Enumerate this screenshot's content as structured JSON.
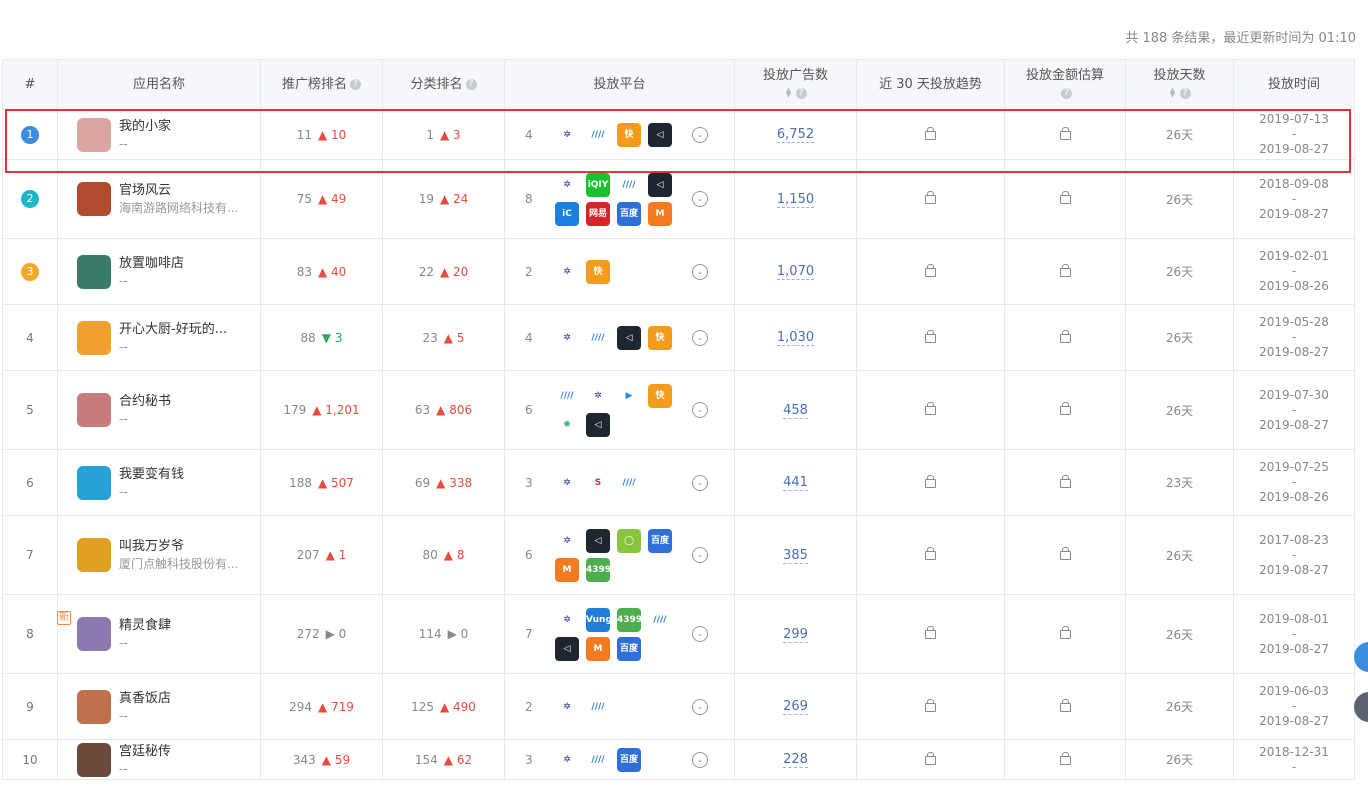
{
  "summary": "共 188 条结果，最近更新时间为 01:10",
  "headers": {
    "idx": "#",
    "name": "应用名称",
    "promo": "推广榜排名",
    "cat": "分类排名",
    "platform": "投放平台",
    "ads": "投放广告数",
    "trend": "近 30 天投放趋势",
    "amount": "投放金额估算",
    "days": "投放天数",
    "time": "投放时间"
  },
  "help_glyph": "?",
  "new_tag": "新",
  "platform_labels": {
    "iqiyi": "iQIY",
    "idea": "iC",
    "wy": "网易",
    "baidu": "百度",
    "vungle": "Vungle",
    "4399": "4399",
    "mgtv": "M",
    "kuaishou": "快"
  },
  "colors": {
    "highlight": "#d9363e",
    "up": "#e84c3d",
    "down": "#27ae60",
    "ads_link": "#4a6fb5",
    "rank1": "#3b8de0",
    "rank2": "#1fb5c9",
    "rank3": "#f5a623"
  },
  "rows": [
    {
      "rank": "1",
      "name": "我的小家",
      "dev": "--",
      "promo": "11",
      "promo_dir": "up",
      "promo_delta": "10",
      "cat": "1",
      "cat_dir": "up",
      "cat_delta": "3",
      "pcount": "4",
      "platforms": [
        "pangle",
        "ks",
        "kuaishou",
        "jl"
      ],
      "ads": "6,752",
      "days": "26天",
      "start": "2019-07-13",
      "sep": "-",
      "end": "2019-08-27",
      "icon": "#d9a7a0"
    },
    {
      "rank": "2",
      "name": "官场风云",
      "dev": "海南游路网络科技有...",
      "promo": "75",
      "promo_dir": "up",
      "promo_delta": "49",
      "cat": "19",
      "cat_dir": "up",
      "cat_delta": "24",
      "pcount": "8",
      "platforms": [
        "pangle",
        "iqiyi",
        "ks",
        "jl",
        "idea",
        "wy",
        "baidu",
        "mgtv"
      ],
      "ads": "1,150",
      "days": "26天",
      "start": "2018-09-08",
      "sep": "-",
      "end": "2019-08-27",
      "icon": "#b34a2e"
    },
    {
      "rank": "3",
      "name": "放置咖啡店",
      "dev": "--",
      "promo": "83",
      "promo_dir": "up",
      "promo_delta": "40",
      "cat": "22",
      "cat_dir": "up",
      "cat_delta": "20",
      "pcount": "2",
      "platforms": [
        "pangle",
        "kuaishou"
      ],
      "ads": "1,070",
      "days": "26天",
      "start": "2019-02-01",
      "sep": "-",
      "end": "2019-08-26",
      "icon": "#3a7a6a"
    },
    {
      "rank": "4",
      "name": "开心大厨-好玩的...",
      "dev": "--",
      "promo": "88",
      "promo_dir": "down",
      "promo_delta": "3",
      "cat": "23",
      "cat_dir": "up",
      "cat_delta": "5",
      "pcount": "4",
      "platforms": [
        "pangle",
        "ks",
        "jl",
        "kuaishou"
      ],
      "ads": "1,030",
      "days": "26天",
      "start": "2019-05-28",
      "sep": "-",
      "end": "2019-08-27",
      "icon": "#f0a030"
    },
    {
      "rank": "5",
      "name": "合约秘书",
      "dev": "--",
      "promo": "179",
      "promo_dir": "up",
      "promo_delta": "1,201",
      "cat": "63",
      "cat_dir": "up",
      "cat_delta": "806",
      "pcount": "6",
      "platforms": [
        "ks",
        "pangle",
        "tx",
        "kuaishou",
        "gdt",
        "jl"
      ],
      "ads": "458",
      "days": "26天",
      "start": "2019-07-30",
      "sep": "-",
      "end": "2019-08-27",
      "icon": "#c77b7b"
    },
    {
      "rank": "6",
      "name": "我要变有钱",
      "dev": "--",
      "promo": "188",
      "promo_dir": "up",
      "promo_delta": "507",
      "cat": "69",
      "cat_dir": "up",
      "cat_delta": "338",
      "pcount": "3",
      "platforms": [
        "pangle",
        "sohu",
        "ks"
      ],
      "ads": "441",
      "days": "23天",
      "start": "2019-07-25",
      "sep": "-",
      "end": "2019-08-26",
      "icon": "#2aa0d8"
    },
    {
      "rank": "7",
      "name": "叫我万岁爷",
      "dev": "厦门点触科技股份有...",
      "promo": "207",
      "promo_dir": "up",
      "promo_delta": "1",
      "cat": "80",
      "cat_dir": "up",
      "cat_delta": "8",
      "pcount": "6",
      "platforms": [
        "pangle",
        "jl",
        "wx",
        "baidu",
        "mgtv",
        "4399"
      ],
      "ads": "385",
      "days": "26天",
      "start": "2017-08-23",
      "sep": "-",
      "end": "2019-08-27",
      "icon": "#e0a020"
    },
    {
      "rank": "8",
      "name": "精灵食肆",
      "dev": "--",
      "promo": "272",
      "promo_dir": "flat",
      "promo_delta": "0",
      "cat": "114",
      "cat_dir": "flat",
      "cat_delta": "0",
      "pcount": "7",
      "platforms": [
        "pangle",
        "vungle",
        "4399",
        "ks",
        "jl",
        "mgtv",
        "baidu"
      ],
      "ads": "299",
      "days": "26天",
      "start": "2019-08-01",
      "sep": "-",
      "end": "2019-08-27",
      "icon": "#8a7ab0"
    },
    {
      "rank": "9",
      "name": "真香饭店",
      "dev": "--",
      "promo": "294",
      "promo_dir": "up",
      "promo_delta": "719",
      "cat": "125",
      "cat_dir": "up",
      "cat_delta": "490",
      "pcount": "2",
      "platforms": [
        "pangle",
        "ks"
      ],
      "ads": "269",
      "days": "26天",
      "start": "2019-06-03",
      "sep": "-",
      "end": "2019-08-27",
      "icon": "#c0704a"
    },
    {
      "rank": "10",
      "name": "宫廷秘传",
      "dev": "--",
      "promo": "343",
      "promo_dir": "up",
      "promo_delta": "59",
      "cat": "154",
      "cat_dir": "up",
      "cat_delta": "62",
      "pcount": "3",
      "platforms": [
        "pangle",
        "ks",
        "baidu"
      ],
      "ads": "228",
      "days": "26天",
      "start": "2018-12-31",
      "sep": "-",
      "end": "",
      "icon": "#6a4a3a"
    }
  ]
}
